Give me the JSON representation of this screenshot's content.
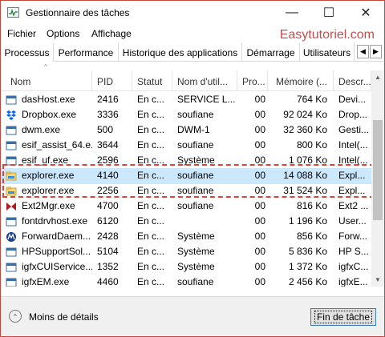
{
  "window": {
    "title": "Gestionnaire des tâches",
    "minimize_glyph": "—",
    "maximize_glyph": "☐",
    "close_glyph": "✕"
  },
  "menu": [
    "Fichier",
    "Options",
    "Affichage"
  ],
  "watermark": "Easytutoriel.com",
  "tabs": [
    "Processus",
    "Performance",
    "Historique des applications",
    "Démarrage",
    "Utilisateurs"
  ],
  "tab_scroll": {
    "left": "◀",
    "right": "▶"
  },
  "columns": [
    "Nom",
    "PID",
    "Statut",
    "Nom d'util...",
    "Pro...",
    "Mémoire (...",
    "Descr..."
  ],
  "sort_glyph": "^",
  "rows": [
    {
      "name": "dasHost.exe",
      "pid": "2416",
      "status": "En c...",
      "user": "SERVICE L...",
      "cpu": "00",
      "memory": "764 Ko",
      "desc": "Devi...",
      "icon": "window-icon",
      "selected": false
    },
    {
      "name": "Dropbox.exe",
      "pid": "3336",
      "status": "En c...",
      "user": "soufiane",
      "cpu": "00",
      "memory": "92 024 Ko",
      "desc": "Drop...",
      "icon": "dropbox-icon",
      "selected": false
    },
    {
      "name": "dwm.exe",
      "pid": "500",
      "status": "En c...",
      "user": "DWM-1",
      "cpu": "00",
      "memory": "32 360 Ko",
      "desc": "Gesti...",
      "icon": "window-icon",
      "selected": false
    },
    {
      "name": "esif_assist_64.e...",
      "pid": "3644",
      "status": "En c...",
      "user": "soufiane",
      "cpu": "00",
      "memory": "800 Ko",
      "desc": "Intel(...",
      "icon": "window-icon",
      "selected": false
    },
    {
      "name": "esif_uf.exe",
      "pid": "2596",
      "status": "En c...",
      "user": "Système",
      "cpu": "00",
      "memory": "1 076 Ko",
      "desc": "Intel(...",
      "icon": "window-icon",
      "selected": false
    },
    {
      "name": "explorer.exe",
      "pid": "4140",
      "status": "En c...",
      "user": "soufiane",
      "cpu": "00",
      "memory": "14 088 Ko",
      "desc": "Expl...",
      "icon": "folder-icon",
      "selected": true
    },
    {
      "name": "explorer.exe",
      "pid": "2256",
      "status": "En c...",
      "user": "soufiane",
      "cpu": "00",
      "memory": "31 524 Ko",
      "desc": "Expl...",
      "icon": "folder-icon",
      "selected": false
    },
    {
      "name": "Ext2Mgr.exe",
      "pid": "4700",
      "status": "En c...",
      "user": "soufiane",
      "cpu": "00",
      "memory": "816 Ko",
      "desc": "Ext2 ...",
      "icon": "ext2-icon",
      "selected": false
    },
    {
      "name": "fontdrvhost.exe",
      "pid": "6120",
      "status": "En c...",
      "user": "",
      "cpu": "00",
      "memory": "1 196 Ko",
      "desc": "User...",
      "icon": "window-icon",
      "selected": false
    },
    {
      "name": "ForwardDaem...",
      "pid": "2428",
      "status": "En c...",
      "user": "Système",
      "cpu": "00",
      "memory": "856 Ko",
      "desc": "Forw...",
      "icon": "motorola-icon",
      "selected": false
    },
    {
      "name": "HPSupportSol...",
      "pid": "5104",
      "status": "En c...",
      "user": "Système",
      "cpu": "00",
      "memory": "5 836 Ko",
      "desc": "HP S...",
      "icon": "window-icon",
      "selected": false
    },
    {
      "name": "igfxCUIService...",
      "pid": "1352",
      "status": "En c...",
      "user": "Système",
      "cpu": "00",
      "memory": "1 372 Ko",
      "desc": "igfxC...",
      "icon": "window-icon",
      "selected": false
    },
    {
      "name": "igfxEM.exe",
      "pid": "4460",
      "status": "En c...",
      "user": "soufiane",
      "cpu": "00",
      "memory": "2 456 Ko",
      "desc": "igfxE...",
      "icon": "window-icon",
      "selected": false
    }
  ],
  "scrollbar": {
    "up": "▲",
    "down": "▼"
  },
  "footer": {
    "less_details": "Moins de détails",
    "chevron": "^",
    "end_task": "Fin de tâche"
  },
  "colors": {
    "accent": "#0078d7",
    "selected_row": "#cce8ff",
    "highlight_dashed": "#d9453a",
    "watermark": "#c0504d",
    "window_border": "#c6473e"
  }
}
